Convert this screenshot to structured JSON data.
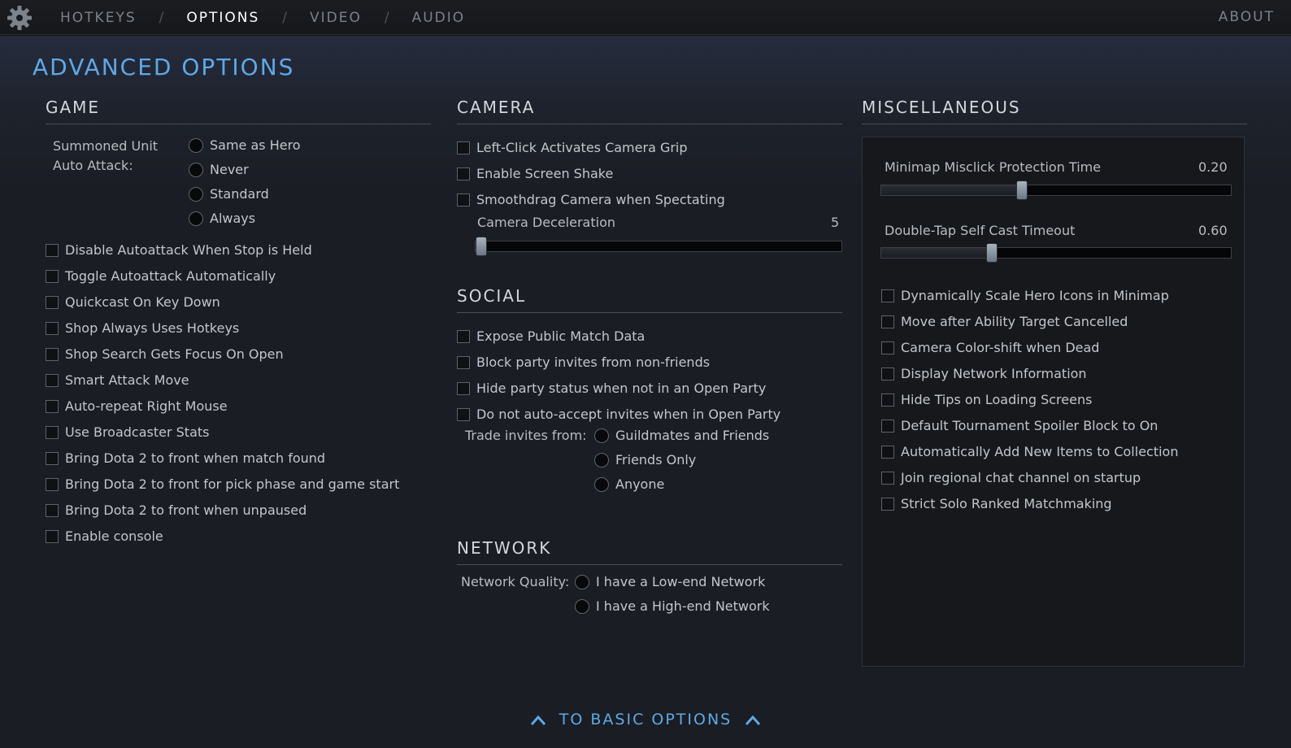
{
  "nav": {
    "tabs": [
      "HOTKEYS",
      "OPTIONS",
      "VIDEO",
      "AUDIO"
    ],
    "separator": "/",
    "active_tab": "OPTIONS",
    "about": "ABOUT"
  },
  "page_title": "ADVANCED OPTIONS",
  "game": {
    "title": "GAME",
    "summoned_label_1": "Summoned Unit",
    "summoned_label_2": "Auto Attack:",
    "summoned_options": [
      "Same as Hero",
      "Never",
      "Standard",
      "Always"
    ],
    "checkboxes": [
      "Disable Autoattack When Stop is Held",
      "Toggle Autoattack Automatically",
      "Quickcast On Key Down",
      "Shop Always Uses Hotkeys",
      "Shop Search Gets Focus On Open",
      "Smart Attack Move",
      "Auto-repeat Right Mouse",
      "Use Broadcaster Stats",
      "Bring Dota 2 to front when match found",
      "Bring Dota 2 to front for pick phase and game start",
      "Bring Dota 2 to front when unpaused",
      "Enable console"
    ]
  },
  "camera": {
    "title": "CAMERA",
    "checkboxes": [
      "Left-Click Activates Camera Grip",
      "Enable Screen Shake",
      "Smoothdrag Camera when Spectating"
    ],
    "deceleration_label": "Camera Deceleration",
    "deceleration_value": "5",
    "deceleration_fraction": 0.0
  },
  "social": {
    "title": "SOCIAL",
    "checkboxes": [
      "Expose Public Match Data",
      "Block party invites from non-friends",
      "Hide party status when not in an Open Party",
      "Do not auto-accept invites when in Open Party"
    ],
    "trade_label": "Trade invites from:",
    "trade_options": [
      "Guildmates and Friends",
      "Friends Only",
      "Anyone"
    ]
  },
  "network": {
    "title": "NETWORK",
    "quality_label": "Network Quality:",
    "quality_options": [
      "I have a Low-end Network",
      "I have a High-end Network"
    ]
  },
  "misc": {
    "title": "MISCELLANEOUS",
    "minimap_label": "Minimap Misclick Protection Time",
    "minimap_value": "0.20",
    "minimap_fraction": 0.4,
    "doubletap_label": "Double-Tap Self Cast Timeout",
    "doubletap_value": "0.60",
    "doubletap_fraction": 0.31,
    "checkboxes": [
      "Dynamically Scale Hero Icons in Minimap",
      "Move after Ability Target Cancelled",
      "Camera Color-shift when Dead",
      "Display Network Information",
      "Hide Tips on Loading Screens",
      "Default Tournament Spoiler Block to On",
      "Automatically Add New Items to Collection",
      "Join regional chat channel on startup",
      "Strict Solo Ranked Matchmaking"
    ]
  },
  "to_basic": "TO BASIC OPTIONS",
  "colors": {
    "accent": "#5fa8e6",
    "background": "#1a1d23"
  }
}
